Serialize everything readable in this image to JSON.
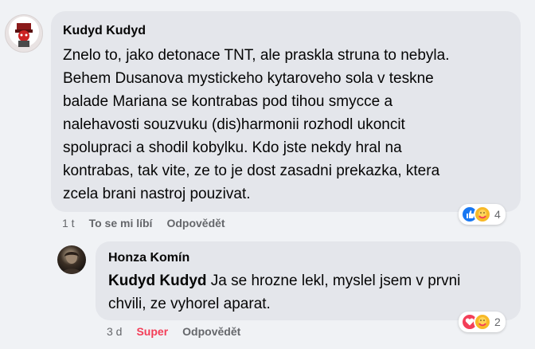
{
  "comment": {
    "author": "Kudyd Kudyd",
    "text": "Znelo to, jako detonace TNT, ale praskla struna to nebyla.\nBehem Dusanova mystickeho kytaroveho sola v teskne\nbalade Mariana se kontrabas pod tihou smycce a\nnalehavosti souzvuku (dis)harmonii rozhodl ukoncit\nspolupraci a shodil kobylku. Kdo jste nekdy hral na\nkontrabas, tak vite, ze to je dost zasadni prekazka, ktera\nzcela brani nastroj pouzivat.",
    "time": "1 t",
    "like_label": "To se mi líbí",
    "reply_label": "Odpovědět",
    "reactions": {
      "icons": [
        "like-icon",
        "care-icon"
      ],
      "count": "4"
    }
  },
  "reply": {
    "author": "Honza Komín",
    "mention": "Kudyd Kudyd",
    "text": " Ja se hrozne lekl, myslel jsem v prvni\nchvili, ze vyhorel aparat.",
    "time": "3 d",
    "reaction_label": "Super",
    "reply_label": "Odpovědět",
    "reactions": {
      "icons": [
        "love-icon",
        "care-icon"
      ],
      "count": "2"
    }
  },
  "colors": {
    "background": "#f0f2f5",
    "bubble": "#e4e6eb",
    "meta_text": "#65676b",
    "like_blue": "#1877f2",
    "care_yellow": "#f7b928",
    "love_red": "#f33e58"
  }
}
